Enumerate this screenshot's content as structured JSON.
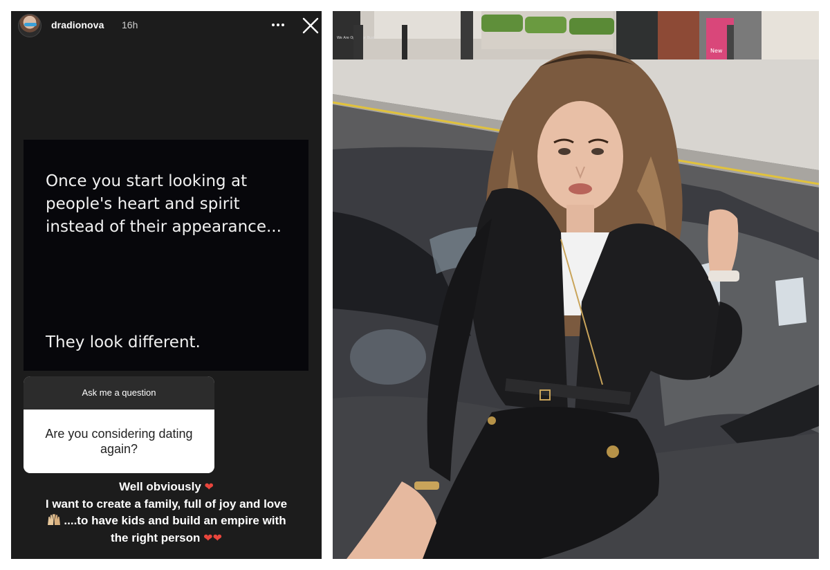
{
  "story": {
    "username": "dradionova",
    "time": "16h",
    "more_icon": "more-horizontal-icon",
    "close_icon": "close-icon",
    "quote": {
      "line1": "Once you start looking at",
      "line2": "people's heart and spirit",
      "line3": "instead of their appearance...",
      "line4": "They look different."
    },
    "question_box": {
      "header": "Ask me a question",
      "question": "Are you considering dating again?"
    },
    "reply": {
      "line1": "Well obviously",
      "line2": "I want to create a family, full of joy and love",
      "line3": "....to have kids and build an empire with",
      "line4": "the right person",
      "heart_glyph": "❤",
      "hands_glyph": "🙌"
    }
  },
  "photo": {
    "sign_text": "We Are Open For Business",
    "poster_text": "New"
  },
  "colors": {
    "story_background": "#1c1c1c",
    "quote_background": "#07070b",
    "question_header": "#2c2c2c",
    "heart": "#e8453c"
  }
}
